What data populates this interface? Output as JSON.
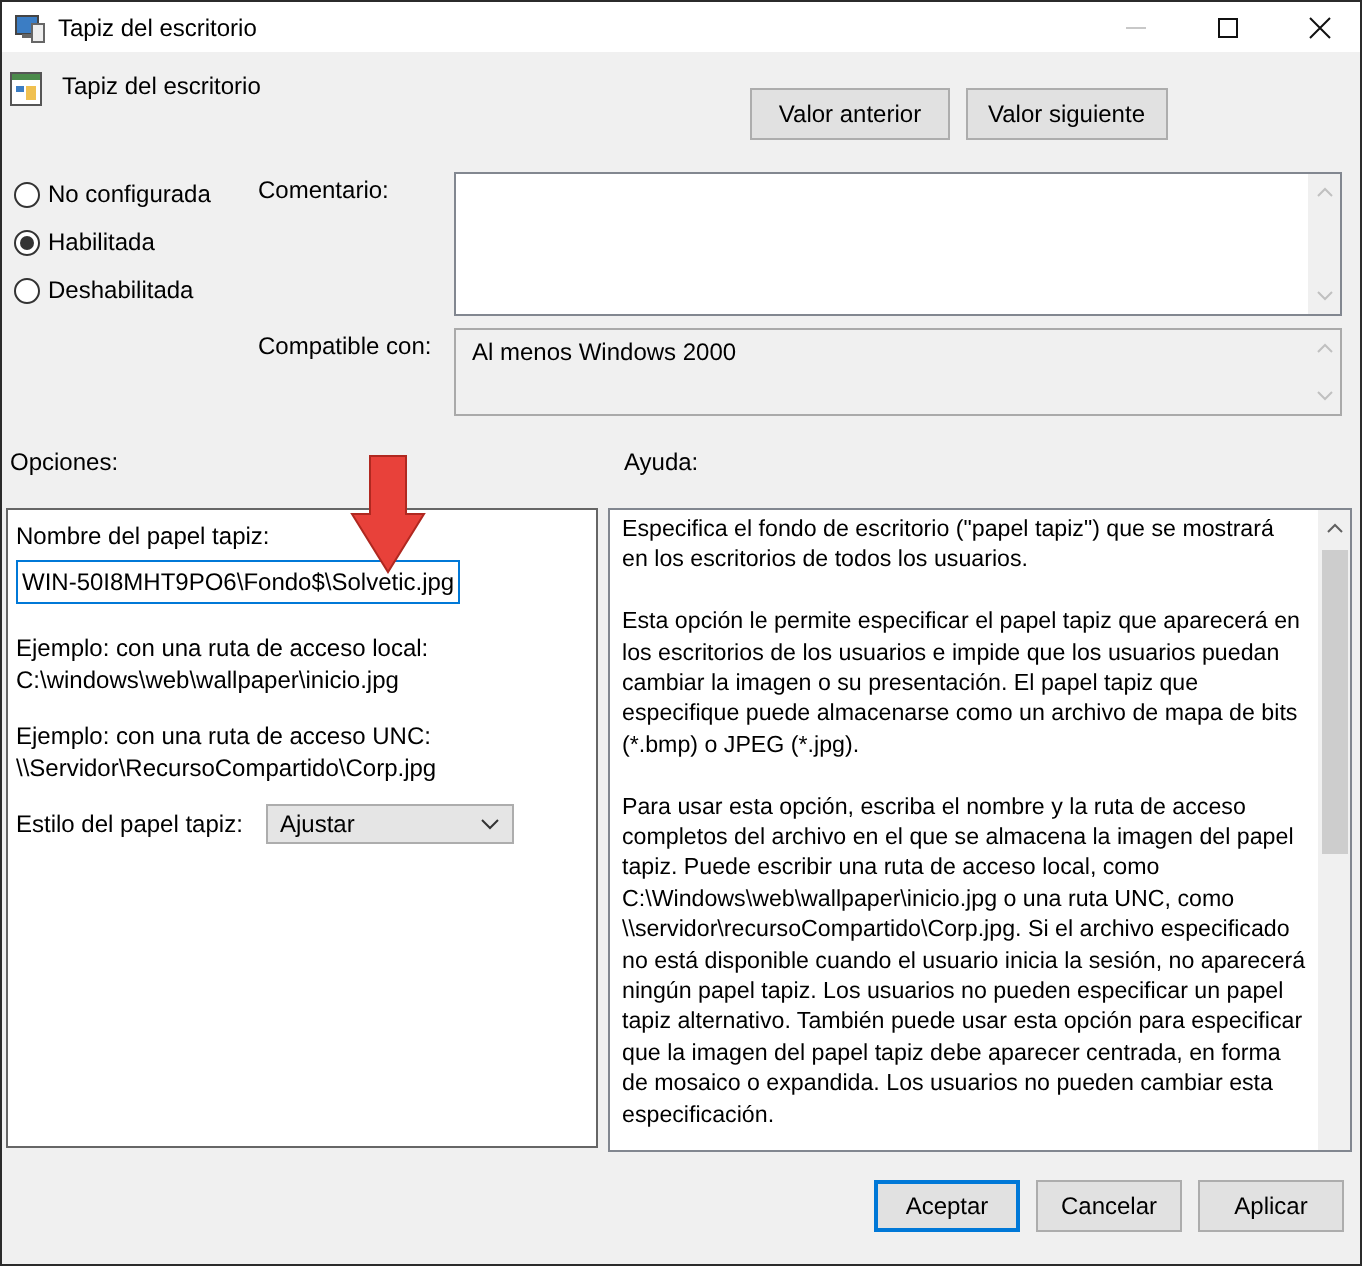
{
  "window": {
    "title": "Tapiz del escritorio",
    "controls": [
      {
        "kind": "minimize",
        "disabled": true
      },
      {
        "kind": "maximize",
        "disabled": false
      },
      {
        "kind": "close",
        "disabled": false
      }
    ]
  },
  "policy": {
    "title": "Tapiz del escritorio"
  },
  "nav_buttons": [
    "Valor anterior",
    "Valor siguiente"
  ],
  "state_options": [
    {
      "label": "No configurada",
      "selected": false
    },
    {
      "label": "Habilitada",
      "selected": true
    },
    {
      "label": "Deshabilitada",
      "selected": false
    }
  ],
  "comment": {
    "label": "Comentario:"
  },
  "compatible": {
    "label": "Compatible con:",
    "value": "Al menos Windows 2000"
  },
  "options": {
    "heading": "Opciones:",
    "name_label": "Nombre del papel tapiz:",
    "name_value": "WIN-50I8MHT9PO6\\Fondo$\\Solvetic.jpg",
    "examples": [
      {
        "label": "Ejemplo: con una ruta de acceso local:",
        "path": "C:\\windows\\web\\wallpaper\\inicio.jpg"
      },
      {
        "label": "Ejemplo: con una ruta de acceso UNC:",
        "path": "\\\\Servidor\\RecursoCompartido\\Corp.jpg"
      }
    ],
    "style_label": "Estilo del papel tapiz:",
    "style_value": "Ajustar"
  },
  "help": {
    "heading": "Ayuda:",
    "paragraphs": [
      "Especifica el fondo de escritorio (\"papel tapiz\") que se mostrará en los escritorios de todos los usuarios.",
      "Esta opción le permite especificar el papel tapiz que aparecerá en los escritorios de los usuarios e impide que los usuarios puedan cambiar la imagen o su presentación. El papel tapiz que especifique puede almacenarse como un archivo de mapa de bits (*.bmp) o JPEG (*.jpg).",
      "Para usar esta opción, escriba el nombre y la ruta de acceso completos del archivo en el que se almacena la imagen del papel tapiz. Puede escribir una ruta de acceso local, como C:\\Windows\\web\\wallpaper\\inicio.jpg o una ruta UNC, como \\\\servidor\\recursoCompartido\\Corp.jpg. Si el archivo especificado no está disponible cuando el usuario inicia la sesión, no aparecerá ningún papel tapiz. Los usuarios no pueden especificar un papel tapiz alternativo. También puede usar esta opción para especificar que la imagen del papel tapiz debe aparecer centrada, en forma de mosaico o expandida. Los usuarios no pueden cambiar esta especificación."
    ]
  },
  "buttons": [
    {
      "label": "Aceptar",
      "focused": true
    },
    {
      "label": "Cancelar",
      "focused": false
    },
    {
      "label": "Aplicar",
      "focused": false
    }
  ]
}
